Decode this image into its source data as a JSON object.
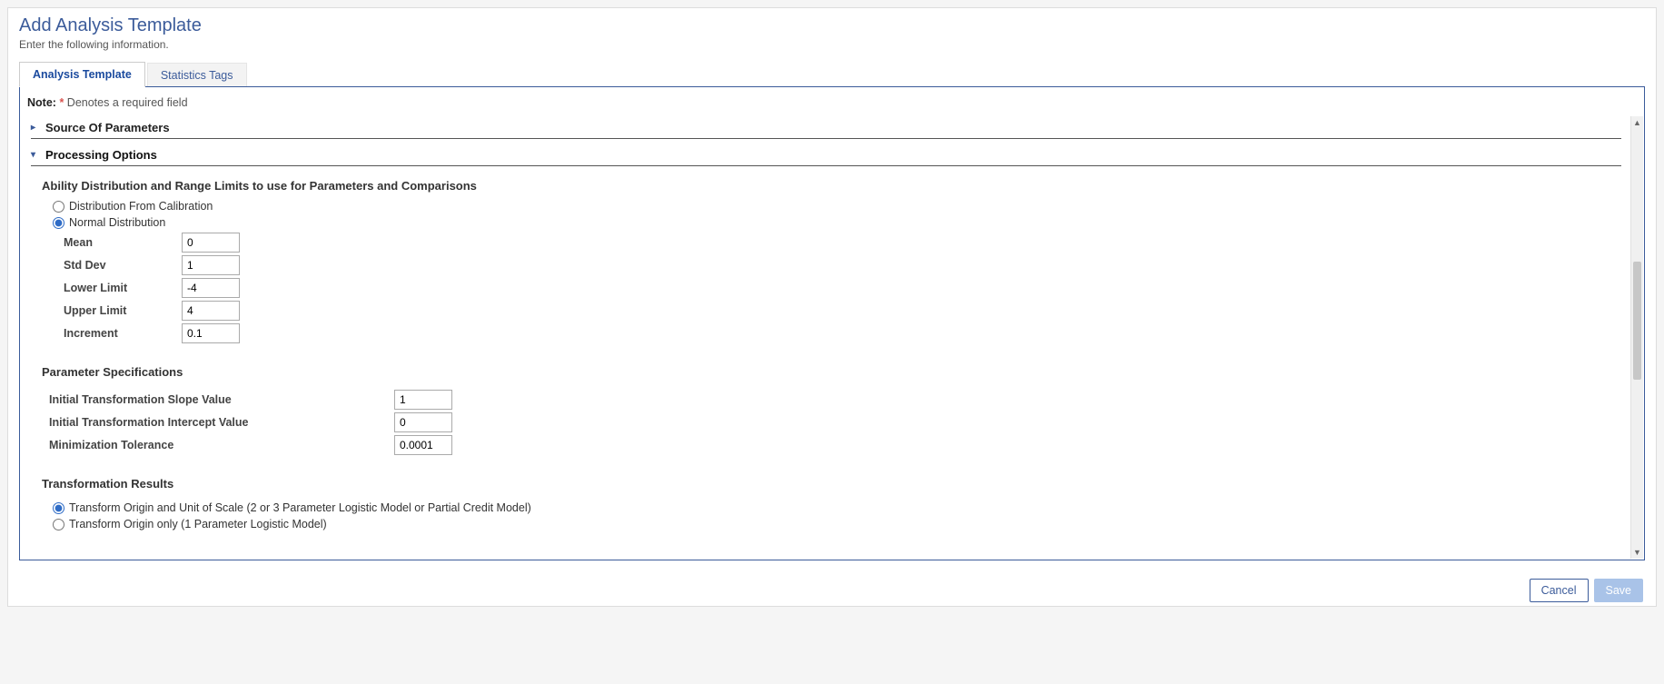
{
  "header": {
    "title": "Add Analysis Template",
    "subtitle": "Enter the following information."
  },
  "tabs": {
    "analysis": "Analysis Template",
    "stats": "Statistics Tags"
  },
  "note": {
    "label": "Note:",
    "asterisk": "*",
    "text": " Denotes a required field"
  },
  "sections": {
    "source": "Source Of Parameters",
    "processing": "Processing Options"
  },
  "ability": {
    "heading": "Ability Distribution and Range Limits to use for Parameters and Comparisons",
    "opt_calibration": "Distribution From Calibration",
    "opt_normal": "Normal Distribution",
    "mean_label": "Mean",
    "mean_val": "0",
    "stddev_label": "Std Dev",
    "stddev_val": "1",
    "lower_label": "Lower Limit",
    "lower_val": "-4",
    "upper_label": "Upper Limit",
    "upper_val": "4",
    "incr_label": "Increment",
    "incr_val": "0.1"
  },
  "spec": {
    "heading": "Parameter Specifications",
    "slope_label": "Initial Transformation Slope Value",
    "slope_val": "1",
    "icept_label": "Initial Transformation Intercept Value",
    "icept_val": "0",
    "mtol_label": "Minimization Tolerance",
    "mtol_val": "0.0001"
  },
  "results": {
    "heading": "Transformation Results",
    "opt_full": "Transform Origin and Unit of Scale (2 or 3 Parameter Logistic Model or Partial Credit Model)",
    "opt_origin": "Transform Origin only (1 Parameter Logistic Model)"
  },
  "buttons": {
    "cancel": "Cancel",
    "save": "Save"
  }
}
